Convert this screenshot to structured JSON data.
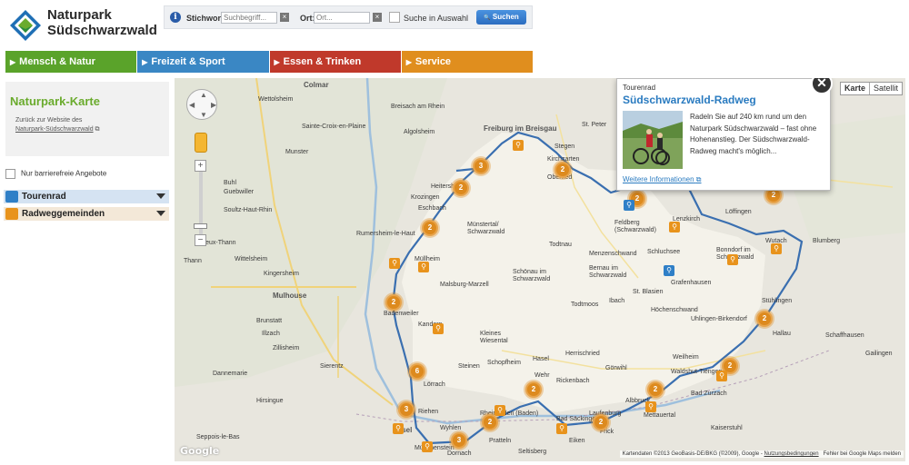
{
  "header": {
    "logo_line1": "Naturpark",
    "logo_line2": "Südschwarzwald"
  },
  "search": {
    "stichwort_label": "Stichwort:",
    "stichwort_placeholder": "Suchbegriff...",
    "ort_label": "Ort:",
    "ort_placeholder": "Ort...",
    "auswahl_label": "Suche in Auswahl",
    "button_label": "Suchen",
    "clear_glyph": "×",
    "info_glyph": "i",
    "search_glyph": "🔍"
  },
  "nav": [
    {
      "label": "Mensch & Natur",
      "color": "#5aa32a"
    },
    {
      "label": "Freizeit & Sport",
      "color": "#3a87c4"
    },
    {
      "label": "Essen & Trinken",
      "color": "#c0392b"
    },
    {
      "label": "Service",
      "color": "#e08e1e"
    }
  ],
  "sidebar": {
    "title": "Naturpark-Karte",
    "back_text": "Zurück zur Website des",
    "back_link": "Naturpark-Südschwarzwald",
    "barrier_label": "Nur barrierefreie Angebote",
    "layers": [
      {
        "label": "Tourenrad",
        "icon": "bike-icon",
        "color": "#2f7fc7",
        "bg": "#d5e3f2"
      },
      {
        "label": "Radweggemeinden",
        "icon": "bike-icon",
        "color": "#e8931c",
        "bg": "#f3e8d8"
      }
    ]
  },
  "map": {
    "type_buttons": [
      "Karte",
      "Satellit"
    ],
    "google_label": "Google",
    "attribution_text": "Kartendaten ©2013 GeoBasis-DE/BKG (©2009), Google -",
    "attribution_link": "Nutzungsbedingungen",
    "report_label": "Fehler bei Google Maps melden",
    "places": [
      {
        "t": "Colmar",
        "big": true
      },
      {
        "t": "Wettolsheim"
      },
      {
        "t": "Breisach am Rhein"
      },
      {
        "t": "Freiburg im Breisgau",
        "big": true
      },
      {
        "t": "St. Peter"
      },
      {
        "t": "Stegen"
      },
      {
        "t": "Kirchzarten"
      },
      {
        "t": "Oberried"
      },
      {
        "t": "Sainte-Croix-en-Plaine"
      },
      {
        "t": "Algolsheim"
      },
      {
        "t": "Munster"
      },
      {
        "t": "Guebwiller"
      },
      {
        "t": "Soultz-Haut-Rhin"
      },
      {
        "t": "Buhl"
      },
      {
        "t": "Heitersheim"
      },
      {
        "t": "Krozingen"
      },
      {
        "t": "Eschbach"
      },
      {
        "t": "Münstertal/ Schwarzwald"
      },
      {
        "t": "Todtnau"
      },
      {
        "t": "Feldberg (Schwarzwald)"
      },
      {
        "t": "Schluchsee"
      },
      {
        "t": "Menzenschwand"
      },
      {
        "t": "Bernau im Schwarzwald"
      },
      {
        "t": "Lenzkirch"
      },
      {
        "t": "Löffingen"
      },
      {
        "t": "Bonndorf im Schwarzwald"
      },
      {
        "t": "Wutach"
      },
      {
        "t": "Blumberg"
      },
      {
        "t": "Grafenhausen"
      },
      {
        "t": "Thann"
      },
      {
        "t": "Wittelsheim"
      },
      {
        "t": "Kingersheim"
      },
      {
        "t": "Müllheim"
      },
      {
        "t": "Malsburg-Marzell"
      },
      {
        "t": "Schönau im Schwarzwald"
      },
      {
        "t": "Todtmoos"
      },
      {
        "t": "Ibach"
      },
      {
        "t": "St. Blasien"
      },
      {
        "t": "Höchenschwand"
      },
      {
        "t": "Mulhouse",
        "big": true
      },
      {
        "t": "Badenweiler"
      },
      {
        "t": "Kandern"
      },
      {
        "t": "Brunstatt"
      },
      {
        "t": "Illzach"
      },
      {
        "t": "Kleines Wiesental"
      },
      {
        "t": "Steinen"
      },
      {
        "t": "Schopfheim"
      },
      {
        "t": "Hasel"
      },
      {
        "t": "Herrischried"
      },
      {
        "t": "Wehr"
      },
      {
        "t": "Rickenbach"
      },
      {
        "t": "Görwihl"
      },
      {
        "t": "Uhlingen-Birkendorf"
      },
      {
        "t": "Stühlingen"
      },
      {
        "t": "Weilheim"
      },
      {
        "t": "Hallau"
      },
      {
        "t": "Schaffhausen"
      },
      {
        "t": "Lörrach"
      },
      {
        "t": "Waldshut-Tiengen"
      },
      {
        "t": "Bad Zurzach"
      },
      {
        "t": "Hirsingue"
      },
      {
        "t": "Sierentz"
      },
      {
        "t": "Basel",
        "big": true
      },
      {
        "t": "Rheinfelden (Baden)"
      },
      {
        "t": "Bad Säckingen"
      },
      {
        "t": "Laufenburg"
      },
      {
        "t": "Albbruck"
      },
      {
        "t": "Mettauertal"
      },
      {
        "t": "Wyhlen"
      },
      {
        "t": "Münchenstein"
      },
      {
        "t": "Pratteln"
      },
      {
        "t": "Riehen"
      },
      {
        "t": "Dornach"
      },
      {
        "t": "Seppois-le-Bas"
      },
      {
        "t": "Dannemarie"
      },
      {
        "t": "Zillisheim"
      },
      {
        "t": "Vieux-Thann"
      },
      {
        "t": "Rumersheim-le-Haut"
      },
      {
        "t": "Gailingen"
      },
      {
        "t": "Kaiserstuhl"
      },
      {
        "t": "Frick"
      },
      {
        "t": "Eiken"
      },
      {
        "t": "Seltisberg"
      }
    ],
    "markers": [
      "3",
      "2",
      "2",
      "2",
      "2",
      "2",
      "6",
      "3",
      "2",
      "2",
      "2",
      "2",
      "3",
      "2",
      "2",
      "2"
    ],
    "bike_icons": 20
  },
  "infowindow": {
    "category": "Tourenrad",
    "title": "Südschwarzwald-Radweg",
    "text": "Radeln Sie auf 240 km rund um den Naturpark Südschwarzwald – fast ohne Hohenanstieg. Der Südschwarzwald-Radweg macht's möglich...",
    "more_link": "Weitere Informationen",
    "close_glyph": "✕"
  }
}
